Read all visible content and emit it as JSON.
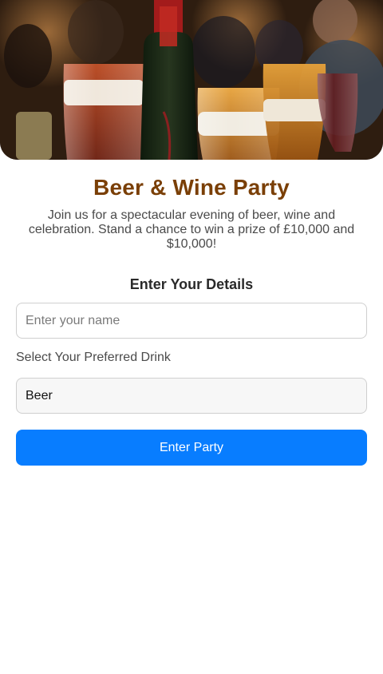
{
  "hero": {
    "image_alt": "Glasses of beer and wine with a bottle at a party"
  },
  "header": {
    "title": "Beer & Wine Party",
    "description": "Join us for a spectacular evening of beer, wine and celebration. Stand a chance to win a prize of £10,000 and $10,000!"
  },
  "form": {
    "heading": "Enter Your Details",
    "name_placeholder": "Enter your name",
    "name_value": "",
    "drink_label": "Select Your Preferred Drink",
    "drink_selected": "Beer",
    "submit_label": "Enter Party"
  },
  "colors": {
    "title": "#7a3f06",
    "button": "#087dff",
    "button_text": "#ffffff"
  }
}
